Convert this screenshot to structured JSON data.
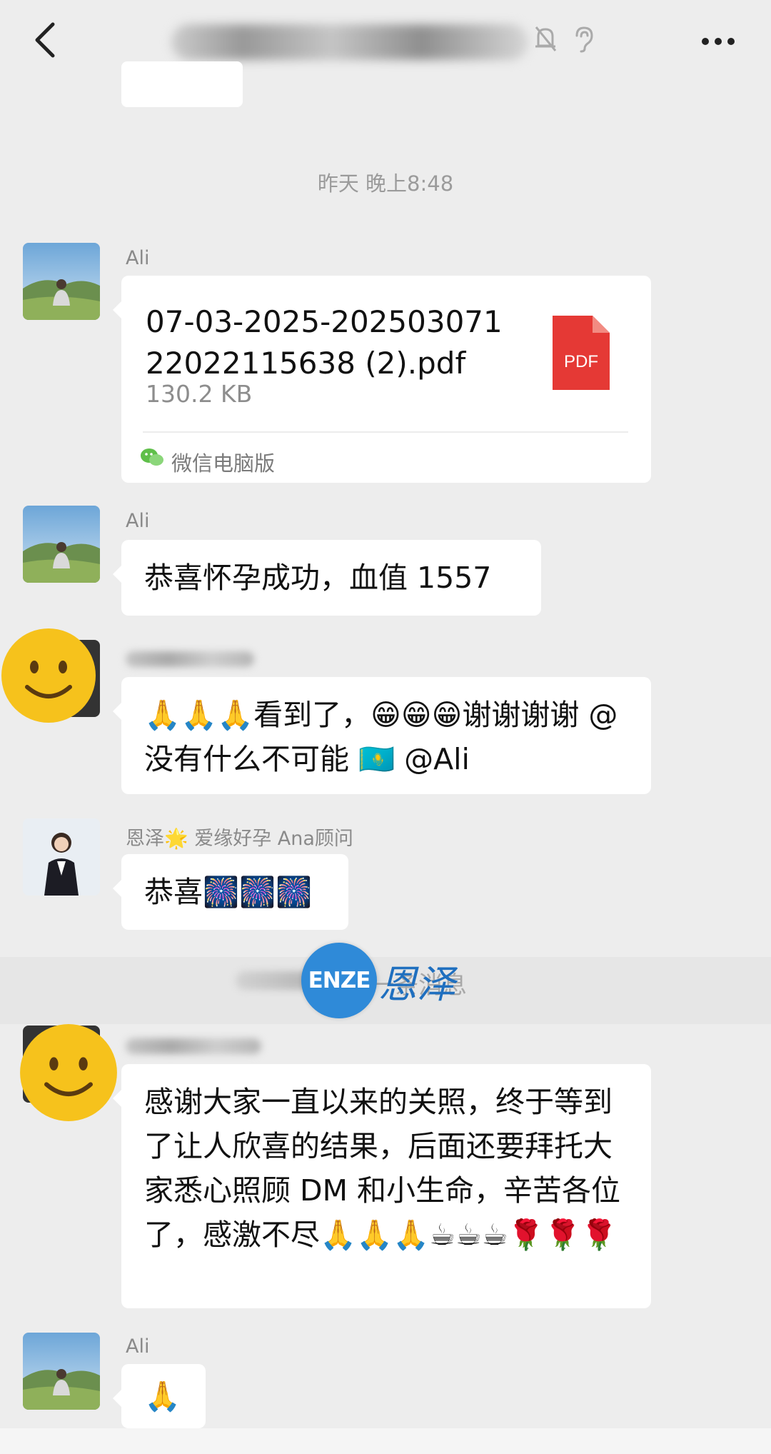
{
  "header": {
    "back_icon": "chevron-left-icon",
    "mute_icon": "bell-slash-icon",
    "ear_icon": "ear-icon",
    "more_icon": "ellipsis-icon"
  },
  "chat": {
    "timestamp": "昨天 晚上8:48",
    "messages": [
      {
        "sender": "Ali",
        "type": "file",
        "file_name": "07-03-2025-20250307122022115638 (2).pdf",
        "file_size": "130.2 KB",
        "file_badge": "PDF",
        "source": "微信电脑版"
      },
      {
        "sender": "Ali",
        "type": "text",
        "text": "恭喜怀孕成功，血值 1557"
      },
      {
        "sender": "",
        "type": "text",
        "text": "🙏🙏🙏看到了，😁😁😁谢谢谢谢 @没有什么不可能 🇰🇿 @Ali"
      },
      {
        "sender": "恩泽🌟 爱缘好孕 Ana顾问",
        "type": "text",
        "text": "恭喜🎆🎆🎆"
      },
      {
        "sender": "",
        "type": "text",
        "text": "感谢大家一直以来的关照，终于等到了让人欣喜的结果，后面还要拜托大家悉心照顾 DM 和小生命，辛苦各位了，感激不尽🙏🙏🙏☕☕☕🌹🌹🌹"
      },
      {
        "sender": "Ali",
        "type": "text",
        "text": "🙏"
      }
    ],
    "recall_notice": "一条消息"
  },
  "watermark": {
    "logo_text": "ENZE",
    "cn_text": "恩泽"
  }
}
